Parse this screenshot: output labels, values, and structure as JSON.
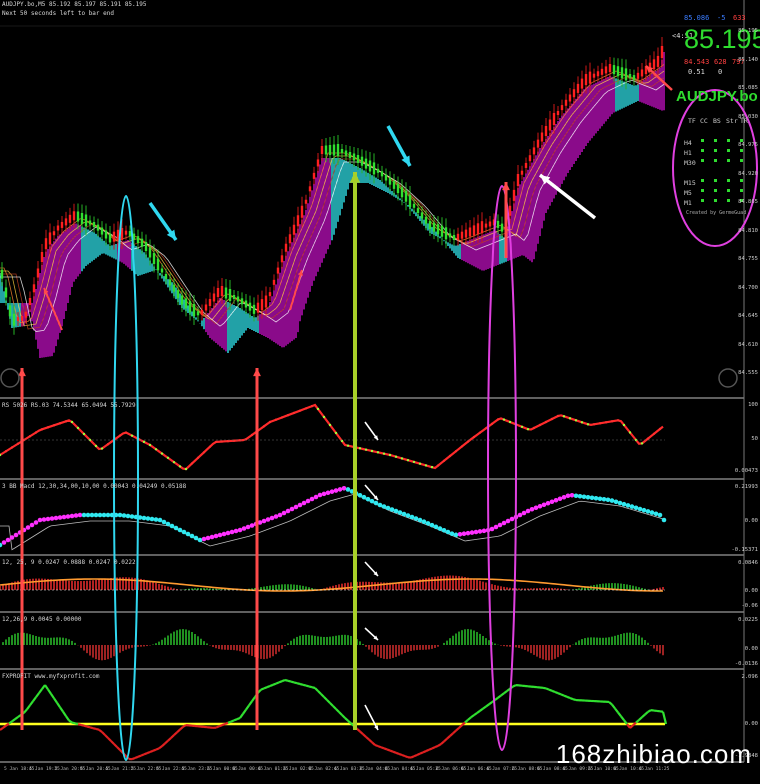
{
  "chart": {
    "symbol_line": "AUDJPY.bo,M5  85.192 85.197 85.191 85.195",
    "status_line": "Next 50 seconds left to bar end"
  },
  "price_panel": {
    "big_price": "85.195",
    "top_small_left": "85.086",
    "top_small_mid": "-5",
    "top_small_right": "633",
    "side_time": "<4:51",
    "row2_left": "84.543",
    "row2_mid": "628",
    "row2_right": "797",
    "row3_left": "0.51",
    "row3_mid": "0",
    "symbol_title": "AUDJPY.bo",
    "columns": [
      "TF",
      "CC",
      "BS",
      "Str",
      "TR"
    ],
    "timeframes": [
      "H4",
      "H1",
      "M30",
      "M15",
      "M5",
      "M1"
    ],
    "credit": "Created by GermeGuad",
    "accent_green": "#2fdc2f",
    "ring_color": "#e040e0"
  },
  "price_axis": [
    "85.195",
    "85.140",
    "85.085",
    "85.030",
    "84.975",
    "84.920",
    "84.865",
    "84.810",
    "84.755",
    "84.700",
    "84.645",
    "84.610",
    "84.555"
  ],
  "indicators": [
    {
      "name": "RSI",
      "header": "RS 5026 RS.03 74.5344 65.0494 55.7929",
      "axis": [
        "100",
        "50",
        "0.00473"
      ]
    },
    {
      "name": "BB Macd",
      "header": "3 BB Macd 12,30,34,00,10,00 0.00043 0.04249 0.05188",
      "axis": [
        "0.21993",
        "0.00",
        "-0.15371"
      ]
    },
    {
      "name": "MACD",
      "header": "12, 25, 9  0.0247 0.0888 0.0247 0.0222",
      "axis": [
        "0.0846",
        "0.00",
        "-0.06"
      ]
    },
    {
      "name": "OsMA",
      "header": "12,26,9  0.0045 0.00000",
      "axis": [
        "0.0225",
        "0.00",
        "-0.0136"
      ]
    },
    {
      "name": "FXPROFIT",
      "header": "FXPROFIT  www.myfxprofit.com",
      "axis": [
        "2.096",
        "0.00",
        "-1.9848"
      ]
    }
  ],
  "time_labels": [
    "5 Jan 18:45",
    "5 Jan 19:25",
    "5 Jan 20:05",
    "5 Jan 20:45",
    "5 Jan 21:25",
    "5 Jan 22:05",
    "5 Jan 22:45",
    "5 Jan 23:25",
    "6 Jan 00:05",
    "6 Jan 00:45",
    "6 Jan 01:25",
    "6 Jan 02:05",
    "6 Jan 02:45",
    "6 Jan 03:25",
    "6 Jan 04:05",
    "6 Jan 04:45",
    "6 Jan 05:25",
    "6 Jan 06:05",
    "6 Jan 06:45",
    "6 Jan 07:25",
    "6 Jan 08:05",
    "6 Jan 08:45",
    "6 Jan 09:25",
    "6 Jan 10:05",
    "6 Jan 10:45",
    "6 Jan 11:25"
  ],
  "watermark": "168zhibiao.com"
}
